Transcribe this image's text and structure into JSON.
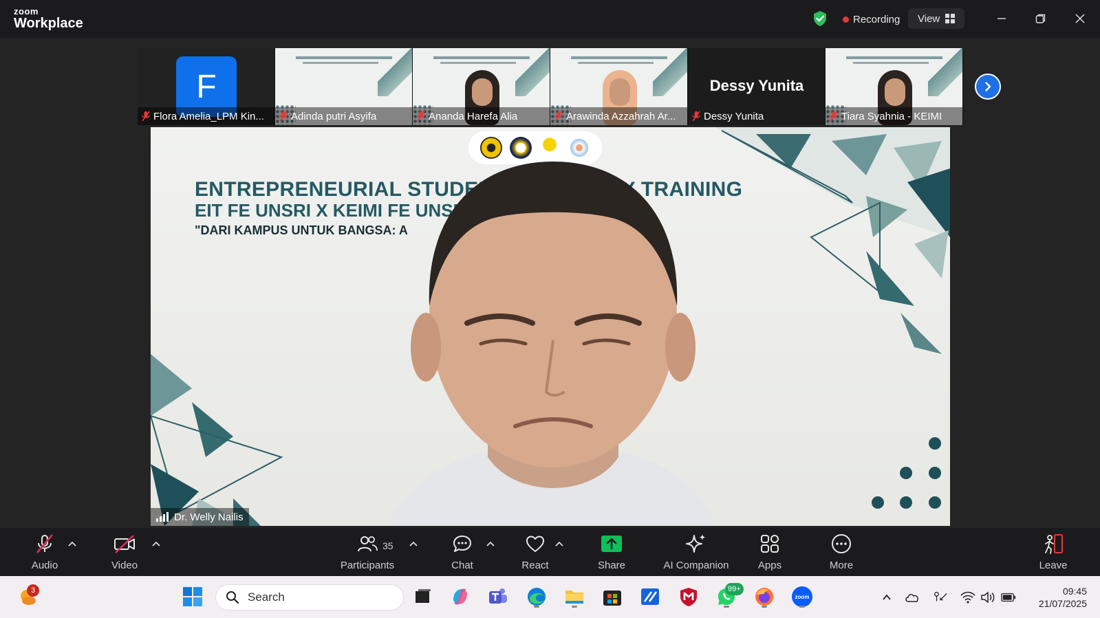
{
  "app": {
    "brand_top": "zoom",
    "brand_bottom": "Workplace"
  },
  "header": {
    "recording_label": "Recording",
    "view_label": "View"
  },
  "thumbnails": [
    {
      "name": "Flora Amelia_LPM Kin...",
      "avatar_letter": "F",
      "type": "avatar"
    },
    {
      "name": "Adinda putri Asyifa",
      "type": "slide"
    },
    {
      "name": "Ananda Harefa Alia",
      "type": "person"
    },
    {
      "name": "Arawinda Azzahrah Ar...",
      "type": "person-hijab"
    },
    {
      "name": "Dessy Yunita",
      "display_name": "Dessy Yunita",
      "type": "name"
    },
    {
      "name": "Tiara Syahnia - KEIMI",
      "type": "person"
    }
  ],
  "main_video": {
    "slide_line1": "ENTREPRENEURIAL STUDENT CREATIVITY TRAINING",
    "slide_line2": "EIT FE UNSRI X KEIMI FE UNSRI",
    "slide_line3": "\"DARI KAMPUS UNTUK BANGSA: A",
    "speaker_name": "Dr. Welly Nailis"
  },
  "toolbar": {
    "audio": "Audio",
    "video": "Video",
    "participants": "Participants",
    "participants_count": "35",
    "chat": "Chat",
    "react": "React",
    "share": "Share",
    "ai_companion": "AI Companion",
    "apps": "Apps",
    "more": "More",
    "leave": "Leave"
  },
  "taskbar": {
    "search_placeholder": "Search",
    "weather_badge": "3",
    "whatsapp_badge": "99+",
    "time": "09:45",
    "date": "21/07/2025"
  },
  "colors": {
    "accent": "#0e71eb",
    "share_green": "#0fbf5a",
    "recording_red": "#e5383b"
  }
}
